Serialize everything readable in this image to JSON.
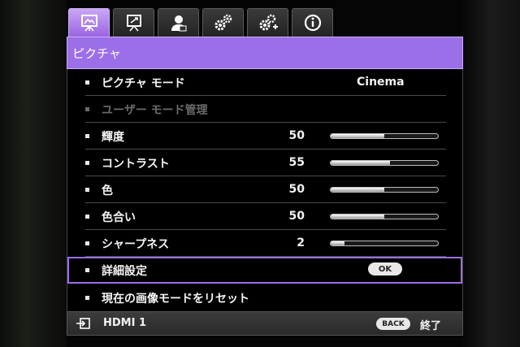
{
  "tabs": [
    {
      "icon": "picture-icon"
    },
    {
      "icon": "display-icon"
    },
    {
      "icon": "user-icon"
    },
    {
      "icon": "settings-gears-icon"
    },
    {
      "icon": "advanced-settings-icon"
    },
    {
      "icon": "info-icon"
    }
  ],
  "header": {
    "title": "ピクチャ"
  },
  "menu": {
    "picture_mode": {
      "label": "ピクチャ モード",
      "value": "Cinema"
    },
    "user_mode": {
      "label": "ユーザー モード管理"
    },
    "brightness": {
      "label": "輝度",
      "value": "50",
      "level": 50
    },
    "contrast": {
      "label": "コントラスト",
      "value": "55",
      "level": 55
    },
    "color": {
      "label": "色",
      "value": "50",
      "level": 50
    },
    "tint": {
      "label": "色合い",
      "value": "50",
      "level": 50
    },
    "sharpness": {
      "label": "シャープネス",
      "value": "2",
      "level": 13
    },
    "advanced": {
      "label": "詳細設定",
      "button": "OK"
    },
    "reset": {
      "label": "現在の画像モードをリセット"
    }
  },
  "footer": {
    "source": "HDMI 1",
    "back_button": "BACK",
    "exit_label": "終了"
  },
  "colors": {
    "accent": "#9c6ee8",
    "accent_light": "#c9a7f3"
  }
}
